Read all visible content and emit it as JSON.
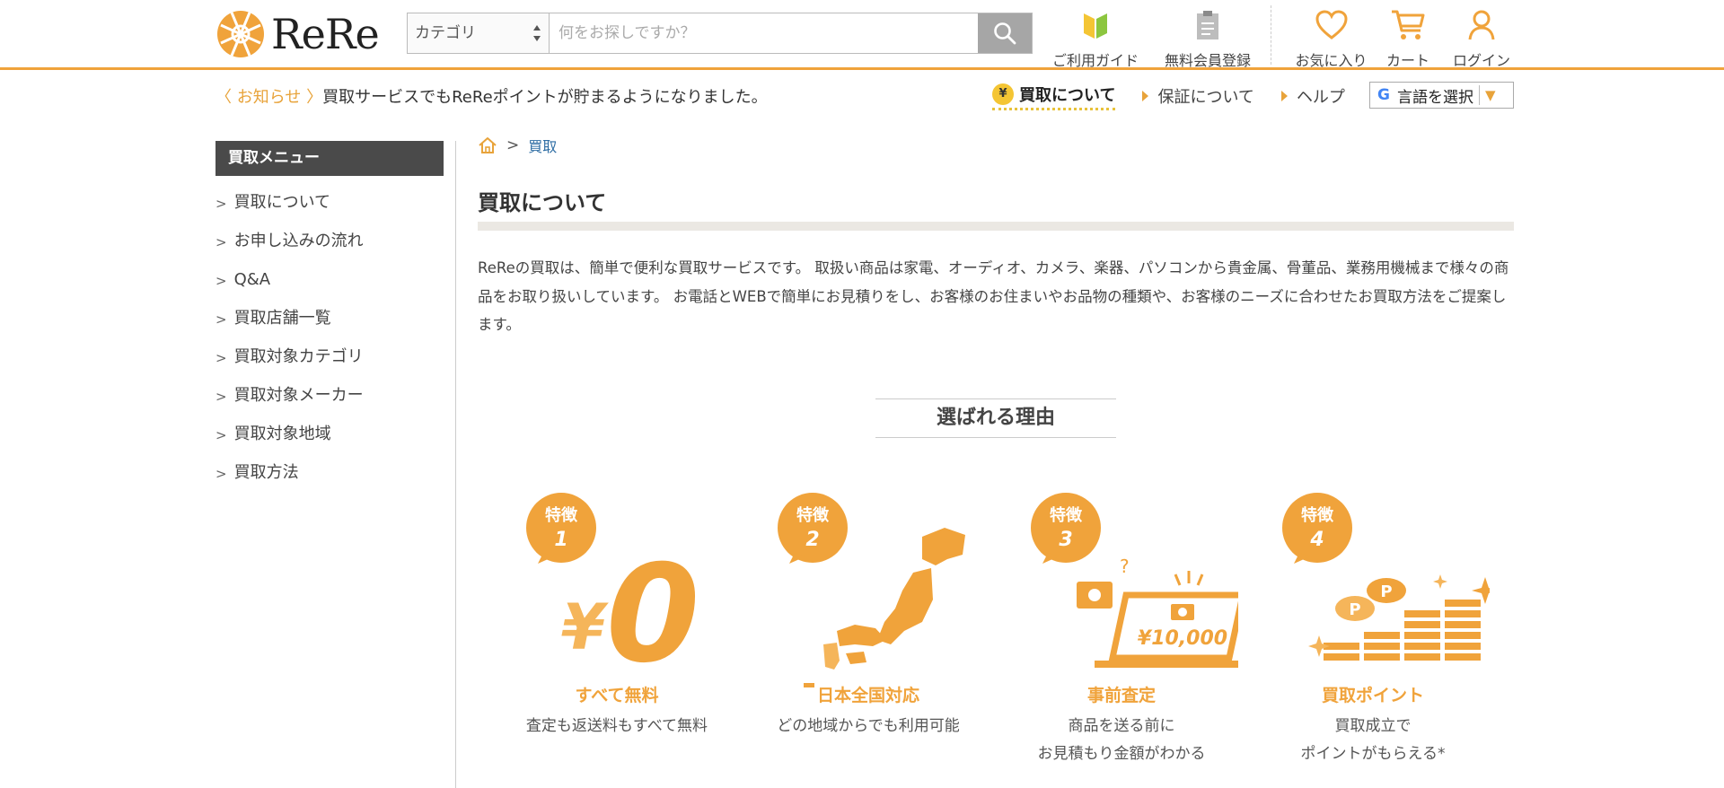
{
  "header": {
    "logo_text": "ReRe",
    "category_label": "カテゴリ",
    "search_placeholder": "何をお探しですか？",
    "nav": [
      {
        "label": "ご利用ガイド",
        "icon": "leaf-icon"
      },
      {
        "label": "無料会員登録",
        "icon": "clipboard-icon"
      },
      {
        "label": "お気に入り",
        "icon": "heart-icon"
      },
      {
        "label": "カート",
        "icon": "cart-icon"
      },
      {
        "label": "ログイン",
        "icon": "user-icon"
      }
    ],
    "accent_color": "#f0a33b"
  },
  "notice": {
    "tag": "〈 お知らせ 〉",
    "text": "買取サービスでもReReポイントが貯まるようになりました。"
  },
  "subnav": {
    "yen": "¥",
    "items": [
      "買取について",
      "保証について",
      "ヘルプ"
    ],
    "language_label": "言語を選択",
    "language_arrow": "▼",
    "google_mark": "G"
  },
  "sidebar": {
    "title": "買取メニュー",
    "items": [
      "買取について",
      "お申し込みの流れ",
      "Q&A",
      "買取店舗一覧",
      "買取対象カテゴリ",
      "買取対象メーカー",
      "買取対象地域",
      "買取方法"
    ]
  },
  "breadcrumb": {
    "current": "買取"
  },
  "main": {
    "title": "買取について",
    "intro": "ReReの買取は、簡単で便利な買取サービスです。 取扱い商品は家電、オーディオ、カメラ、楽器、パソコンから貴金属、骨董品、業務用機械まで様々の商品をお取り扱いしています。 お電話とWEBで簡単にお見積りをし、お客様のお住まいやお品物の種類や、お客様のニーズに合わせたお買取方法をご提案します。",
    "reasons_title": "選ばれる理由",
    "features": [
      {
        "badge_top": "特徴",
        "badge_num": "1",
        "title": "すべて無料",
        "desc1": "査定も返送料もすべて無料",
        "desc2": "",
        "illus_text": "¥0"
      },
      {
        "badge_top": "特徴",
        "badge_num": "2",
        "title": "日本全国対応",
        "desc1": "どの地域からでも利用可能",
        "desc2": "",
        "illus_text": ""
      },
      {
        "badge_top": "特徴",
        "badge_num": "3",
        "title": "事前査定",
        "desc1": "商品を送る前に",
        "desc2": "お見積もり金額がわかる",
        "illus_text": "¥10,000"
      },
      {
        "badge_top": "特徴",
        "badge_num": "4",
        "title": "買取ポイント",
        "desc1": "買取成立で",
        "desc2": "ポイントがもらえる*",
        "illus_text": "P"
      }
    ]
  }
}
